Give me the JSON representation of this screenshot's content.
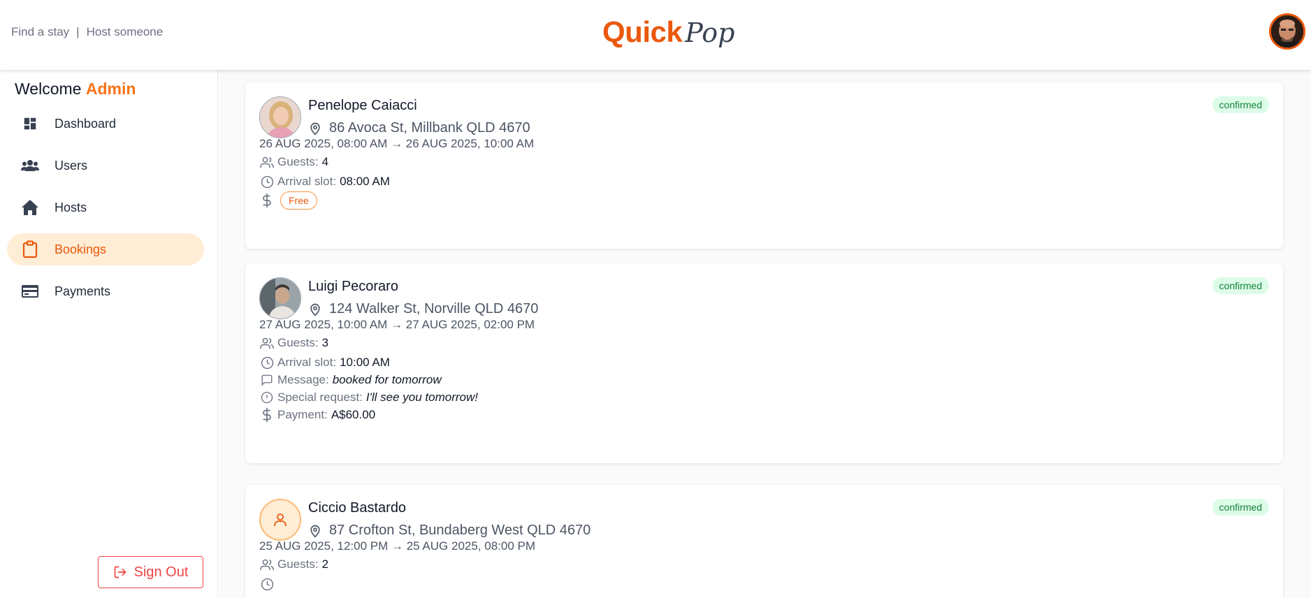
{
  "header": {
    "nav_find": "Find a stay",
    "nav_sep": "|",
    "nav_host": "Host someone",
    "logo_quick": "Quick",
    "logo_pop": "Pop"
  },
  "sidebar": {
    "welcome_prefix": "Welcome",
    "welcome_name": "Admin",
    "items": [
      {
        "label": "Dashboard",
        "icon": "dashboard-icon"
      },
      {
        "label": "Users",
        "icon": "users-icon"
      },
      {
        "label": "Hosts",
        "icon": "home-icon"
      },
      {
        "label": "Bookings",
        "icon": "clipboard-icon",
        "active": true
      },
      {
        "label": "Payments",
        "icon": "credit-card-icon"
      }
    ],
    "signout_label": "Sign Out"
  },
  "bookings": [
    {
      "name": "Penelope Caiacci",
      "address": "86 Avoca St, Millbank QLD 4670",
      "dates": "26 AUG 2025, 08:00 AM → 26 AUG 2025, 10:00 AM",
      "guests_label": "Guests:",
      "guests": "4",
      "arrival_label": "Arrival slot:",
      "arrival": "08:00 AM",
      "price_badge": "Free",
      "status": "confirmed"
    },
    {
      "name": "Luigi Pecoraro",
      "address": "124 Walker St, Norville QLD 4670",
      "dates": "27 AUG 2025, 10:00 AM → 27 AUG 2025, 02:00 PM",
      "guests_label": "Guests:",
      "guests": "3",
      "arrival_label": "Arrival slot:",
      "arrival": "10:00 AM",
      "message_label": "Message:",
      "message": "booked for tomorrow",
      "request_label": "Special request:",
      "request": "I'll see you tomorrow!",
      "payment_label": "Payment:",
      "payment": "A$60.00",
      "status": "confirmed"
    },
    {
      "name": "Ciccio Bastardo",
      "address": "87 Crofton St, Bundaberg West QLD 4670",
      "dates": "25 AUG 2025, 12:00 PM → 25 AUG 2025, 08:00 PM",
      "guests_label": "Guests:",
      "guests": "2",
      "status": "confirmed"
    }
  ],
  "colors": {
    "accent": "#ea580c",
    "accent_light": "#ffedd5",
    "status_bg": "#dcfce7",
    "status_text": "#15803d",
    "danger": "#ef4444"
  }
}
